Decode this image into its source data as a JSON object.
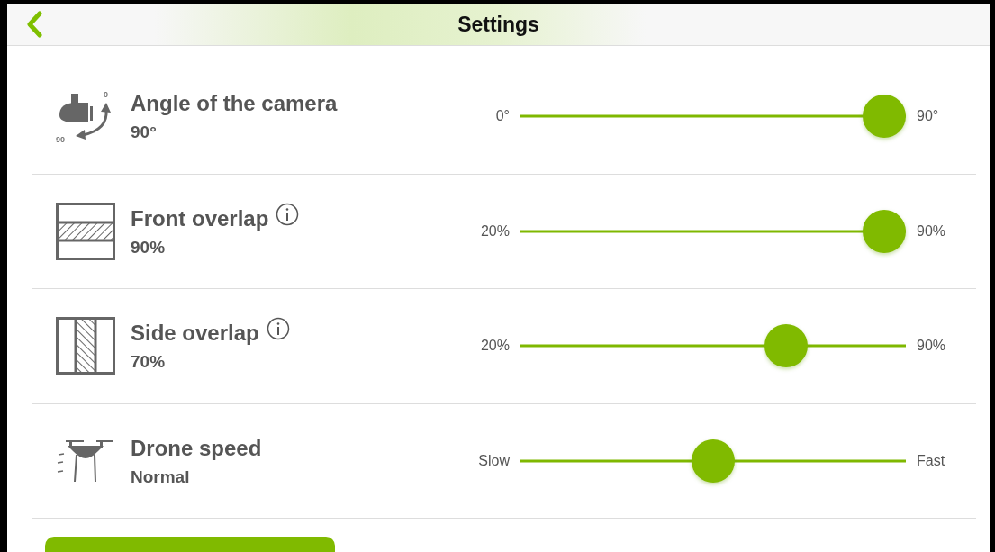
{
  "header": {
    "title": "Settings"
  },
  "rows": [
    {
      "kind": "camera",
      "title": "Angle of the camera",
      "value": "90°",
      "info": false,
      "icon_labels": [
        "0",
        "90"
      ],
      "min_label": "0°",
      "max_label": "90°",
      "level": 1
    },
    {
      "kind": "front",
      "title": "Front overlap",
      "value": "90%",
      "info": true,
      "min_label": "20%",
      "max_label": "90%",
      "level": 1
    },
    {
      "kind": "side",
      "title": "Side overlap",
      "value": "70%",
      "info": true,
      "min_label": "20%",
      "max_label": "90%",
      "level": 0.714
    },
    {
      "kind": "drone",
      "title": "Drone speed",
      "value": "Normal",
      "info": false,
      "min_label": "Slow",
      "max_label": "Fast",
      "level": 0.5
    }
  ]
}
